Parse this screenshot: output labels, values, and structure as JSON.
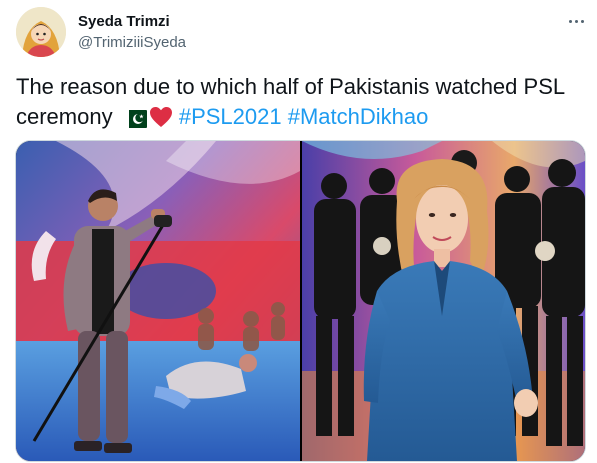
{
  "author": {
    "display_name": "Syeda Trimzi",
    "handle": "@TrimiziiiSyeda"
  },
  "tweet": {
    "text": "The reason due to which half of Pakistanis watched PSL ceremony",
    "emojis": [
      "pakistan-flag-icon",
      "red-heart-icon"
    ],
    "hashtags": [
      "#PSL2021",
      "#MatchDikhao"
    ]
  },
  "media": {
    "photos": [
      {
        "label": "singer-on-stage-photo"
      },
      {
        "label": "singer-in-blue-suit-photo"
      }
    ]
  },
  "colors": {
    "hashtag": "#1d9bf0",
    "text": "#0f1419",
    "secondary": "#536471",
    "border": "#cfd9de"
  }
}
